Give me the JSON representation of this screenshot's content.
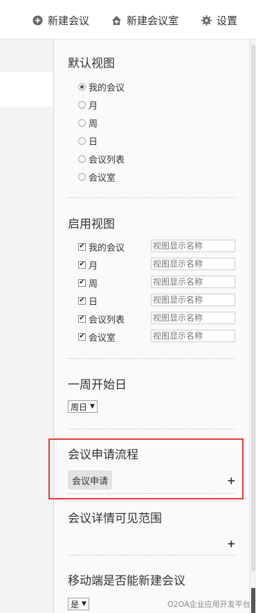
{
  "toolbar": {
    "new_meeting": "新建会议",
    "new_room": "新建会议室",
    "settings": "设置"
  },
  "default_view": {
    "title": "默认视图",
    "options": [
      {
        "label": "我的会议",
        "selected": true
      },
      {
        "label": "月",
        "selected": false
      },
      {
        "label": "周",
        "selected": false
      },
      {
        "label": "日",
        "selected": false
      },
      {
        "label": "会议列表",
        "selected": false
      },
      {
        "label": "会议室",
        "selected": false
      }
    ]
  },
  "enabled_views": {
    "title": "启用视图",
    "items": [
      {
        "label": "我的会议",
        "checked": true,
        "placeholder": "视图显示名称"
      },
      {
        "label": "月",
        "checked": true,
        "placeholder": "视图显示名称"
      },
      {
        "label": "周",
        "checked": true,
        "placeholder": "视图显示名称"
      },
      {
        "label": "日",
        "checked": true,
        "placeholder": "视图显示名称"
      },
      {
        "label": "会议列表",
        "checked": true,
        "placeholder": "视图显示名称"
      },
      {
        "label": "会议室",
        "checked": true,
        "placeholder": "视图显示名称"
      }
    ]
  },
  "week_start": {
    "title": "一周开始日",
    "value": "周日"
  },
  "apply_process": {
    "title": "会议申请流程",
    "tag": "会议申请"
  },
  "detail_scope": {
    "title": "会议详情可见范围"
  },
  "mobile_create": {
    "title": "移动端是否能新建会议",
    "value": "是"
  },
  "watermark": "O2OA企业应用开发平台"
}
